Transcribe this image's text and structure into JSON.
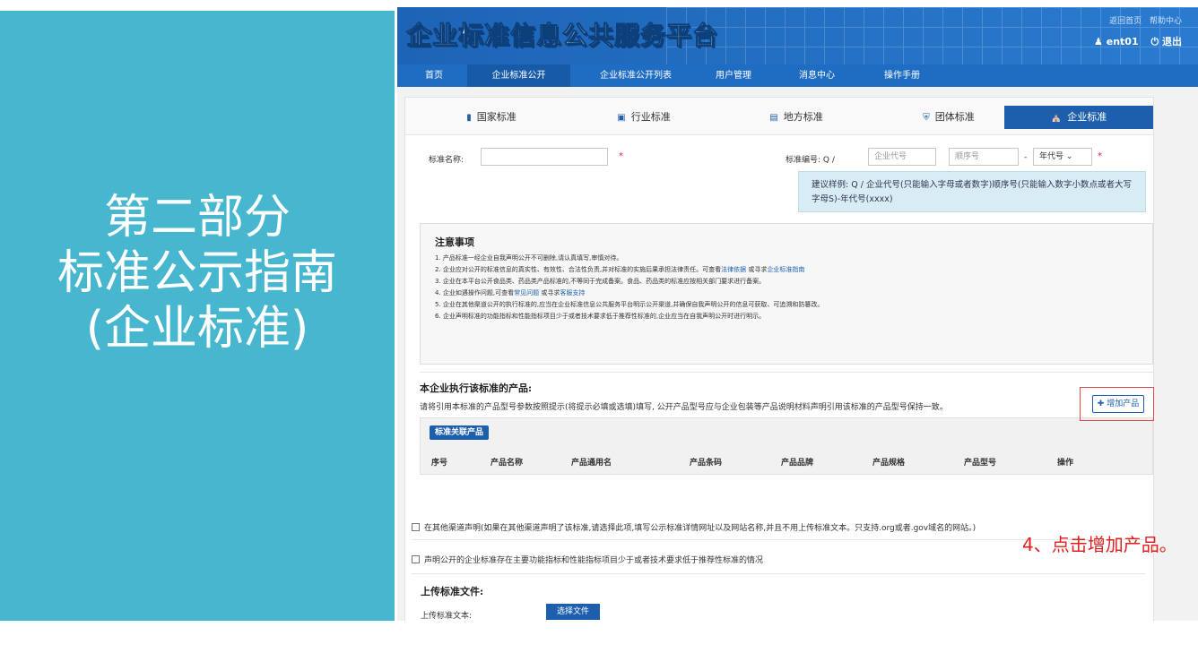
{
  "slide": {
    "title_lines": [
      "第二部分",
      "标准公示指南",
      "(企业标准)"
    ],
    "callout": "4、点击增加产品。"
  },
  "header": {
    "logo": "企业标准信息公共服务平台",
    "links": [
      "返回首页",
      "帮助中心"
    ],
    "user": "ent01",
    "logout": "退出"
  },
  "nav": {
    "items": [
      "首页",
      "企业标准公开",
      "企业标准公开列表",
      "用户管理",
      "消息中心",
      "操作手册"
    ],
    "active": "企业标准公开"
  },
  "std_tabs": {
    "items": [
      {
        "label": "国家标准",
        "icon": "book-icon"
      },
      {
        "label": "行业标准",
        "icon": "briefcase-icon"
      },
      {
        "label": "地方标准",
        "icon": "file-icon"
      },
      {
        "label": "团体标准",
        "icon": "shield-icon"
      },
      {
        "label": "企业标准",
        "icon": "bank-icon"
      }
    ],
    "active": "企业标准"
  },
  "form": {
    "name_label": "标准名称:",
    "name_value": "",
    "number_label": "标准编号: Q /",
    "company_code_placeholder": "企业代号",
    "sequence_placeholder": "顺序号",
    "dash": "-",
    "year_placeholder": "年代号",
    "required_mark": "*",
    "hint": "建议样例: Q / 企业代号(只能输入字母或者数字)顺序号(只能输入数字小数点或者大写字母S)-年代号(xxxx)"
  },
  "notice": {
    "title": "注意事项",
    "lines": [
      {
        "text": "1. 产品标准一经企业自我声明公开不可删除,请认真填写,审慎对待。"
      },
      {
        "pre": "2. 企业应对公开的标准信息的真实性、有效性、合法性负责,并对标准的实施后果承担法律责任。可查看",
        "link1": "法律依据",
        "mid": " 或寻求",
        "link2": "企业标准指南",
        "post": ""
      },
      {
        "text": "3. 企业在本平台公开食品类、药品类产品标准的,不等同于完成备案。食品、药品类的标准应按相关部门要求进行备案。"
      },
      {
        "pre": "4. 企业如遇操作问题,可查看",
        "link1": "常见问题",
        "mid": " 或寻求",
        "link2": "客服支持",
        "post": ""
      },
      {
        "text": "5. 企业在其他渠道公开的执行标准的,应当在企业标准信息公共服务平台明示公开渠道,并确保自我声明公开的信息可获取、可追溯和防篡改。"
      },
      {
        "text": "6. 企业声明标准的功能指标和性能指标项目少于或者技术要求低于推荐性标准的,企业应当在自我声明公开时进行明示。"
      }
    ]
  },
  "products": {
    "title": "本企业执行该标准的产品:",
    "description": "请将引用本标准的产品型号参数按照提示(将提示必填或选填)填写, 公开产品型号应与企业包装等产品说明材料声明引用该标准的产品型号保持一致。",
    "tag": "标准关联产品",
    "columns": [
      "序号",
      "产品名称",
      "产品通用名",
      "产品条码",
      "产品品牌",
      "产品规格",
      "产品型号",
      "操作"
    ],
    "add_button": "增加产品"
  },
  "checks": {
    "other_channel": "在其他渠道声明(如果在其他渠道声明了该标准,请选择此项,填写公示标准详情网址以及网站名称,并且不用上传标准文本。只支持.org或者.gov域名的网站。)",
    "lower_than": "声明公开的企业标准存在主要功能指标和性能指标项目少于或者技术要求低于推荐性标准的情况"
  },
  "upload": {
    "title": "上传标准文件:",
    "label": "上传标准文本:",
    "button": "选择文件"
  }
}
